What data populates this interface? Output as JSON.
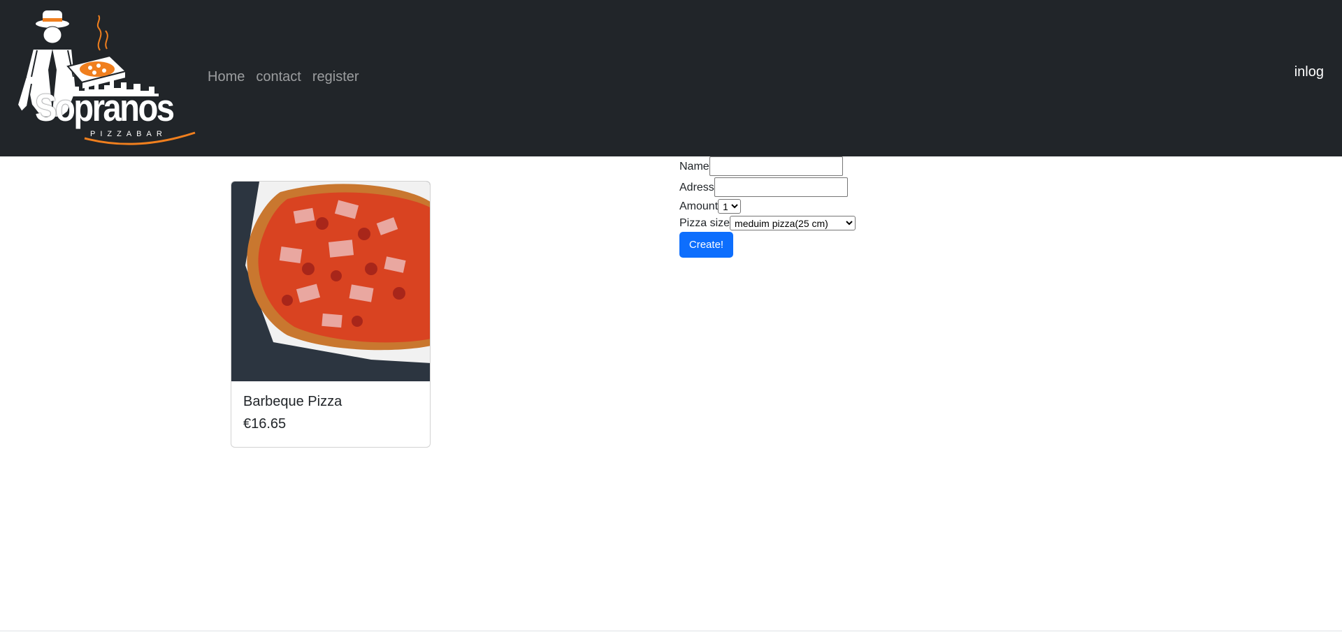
{
  "brand": {
    "name": "Sopranos",
    "tagline": "PIZZABAR"
  },
  "nav": {
    "links": [
      {
        "label": "Home"
      },
      {
        "label": "contact"
      },
      {
        "label": "register"
      }
    ],
    "login_label": "inlog"
  },
  "product": {
    "title": "Barbeque Pizza",
    "price": "€16.65"
  },
  "order_form": {
    "name_label": "Name",
    "name_value": "",
    "address_label": "Adress",
    "address_value": "",
    "amount_label": "Amount",
    "amount_selected": "1",
    "size_label": "Pizza size",
    "size_selected": "meduim pizza(25 cm)",
    "submit_label": "Create!"
  },
  "colors": {
    "navbar_bg": "#212529",
    "accent_orange": "#f07f1e",
    "button_primary": "#0d6efd"
  }
}
